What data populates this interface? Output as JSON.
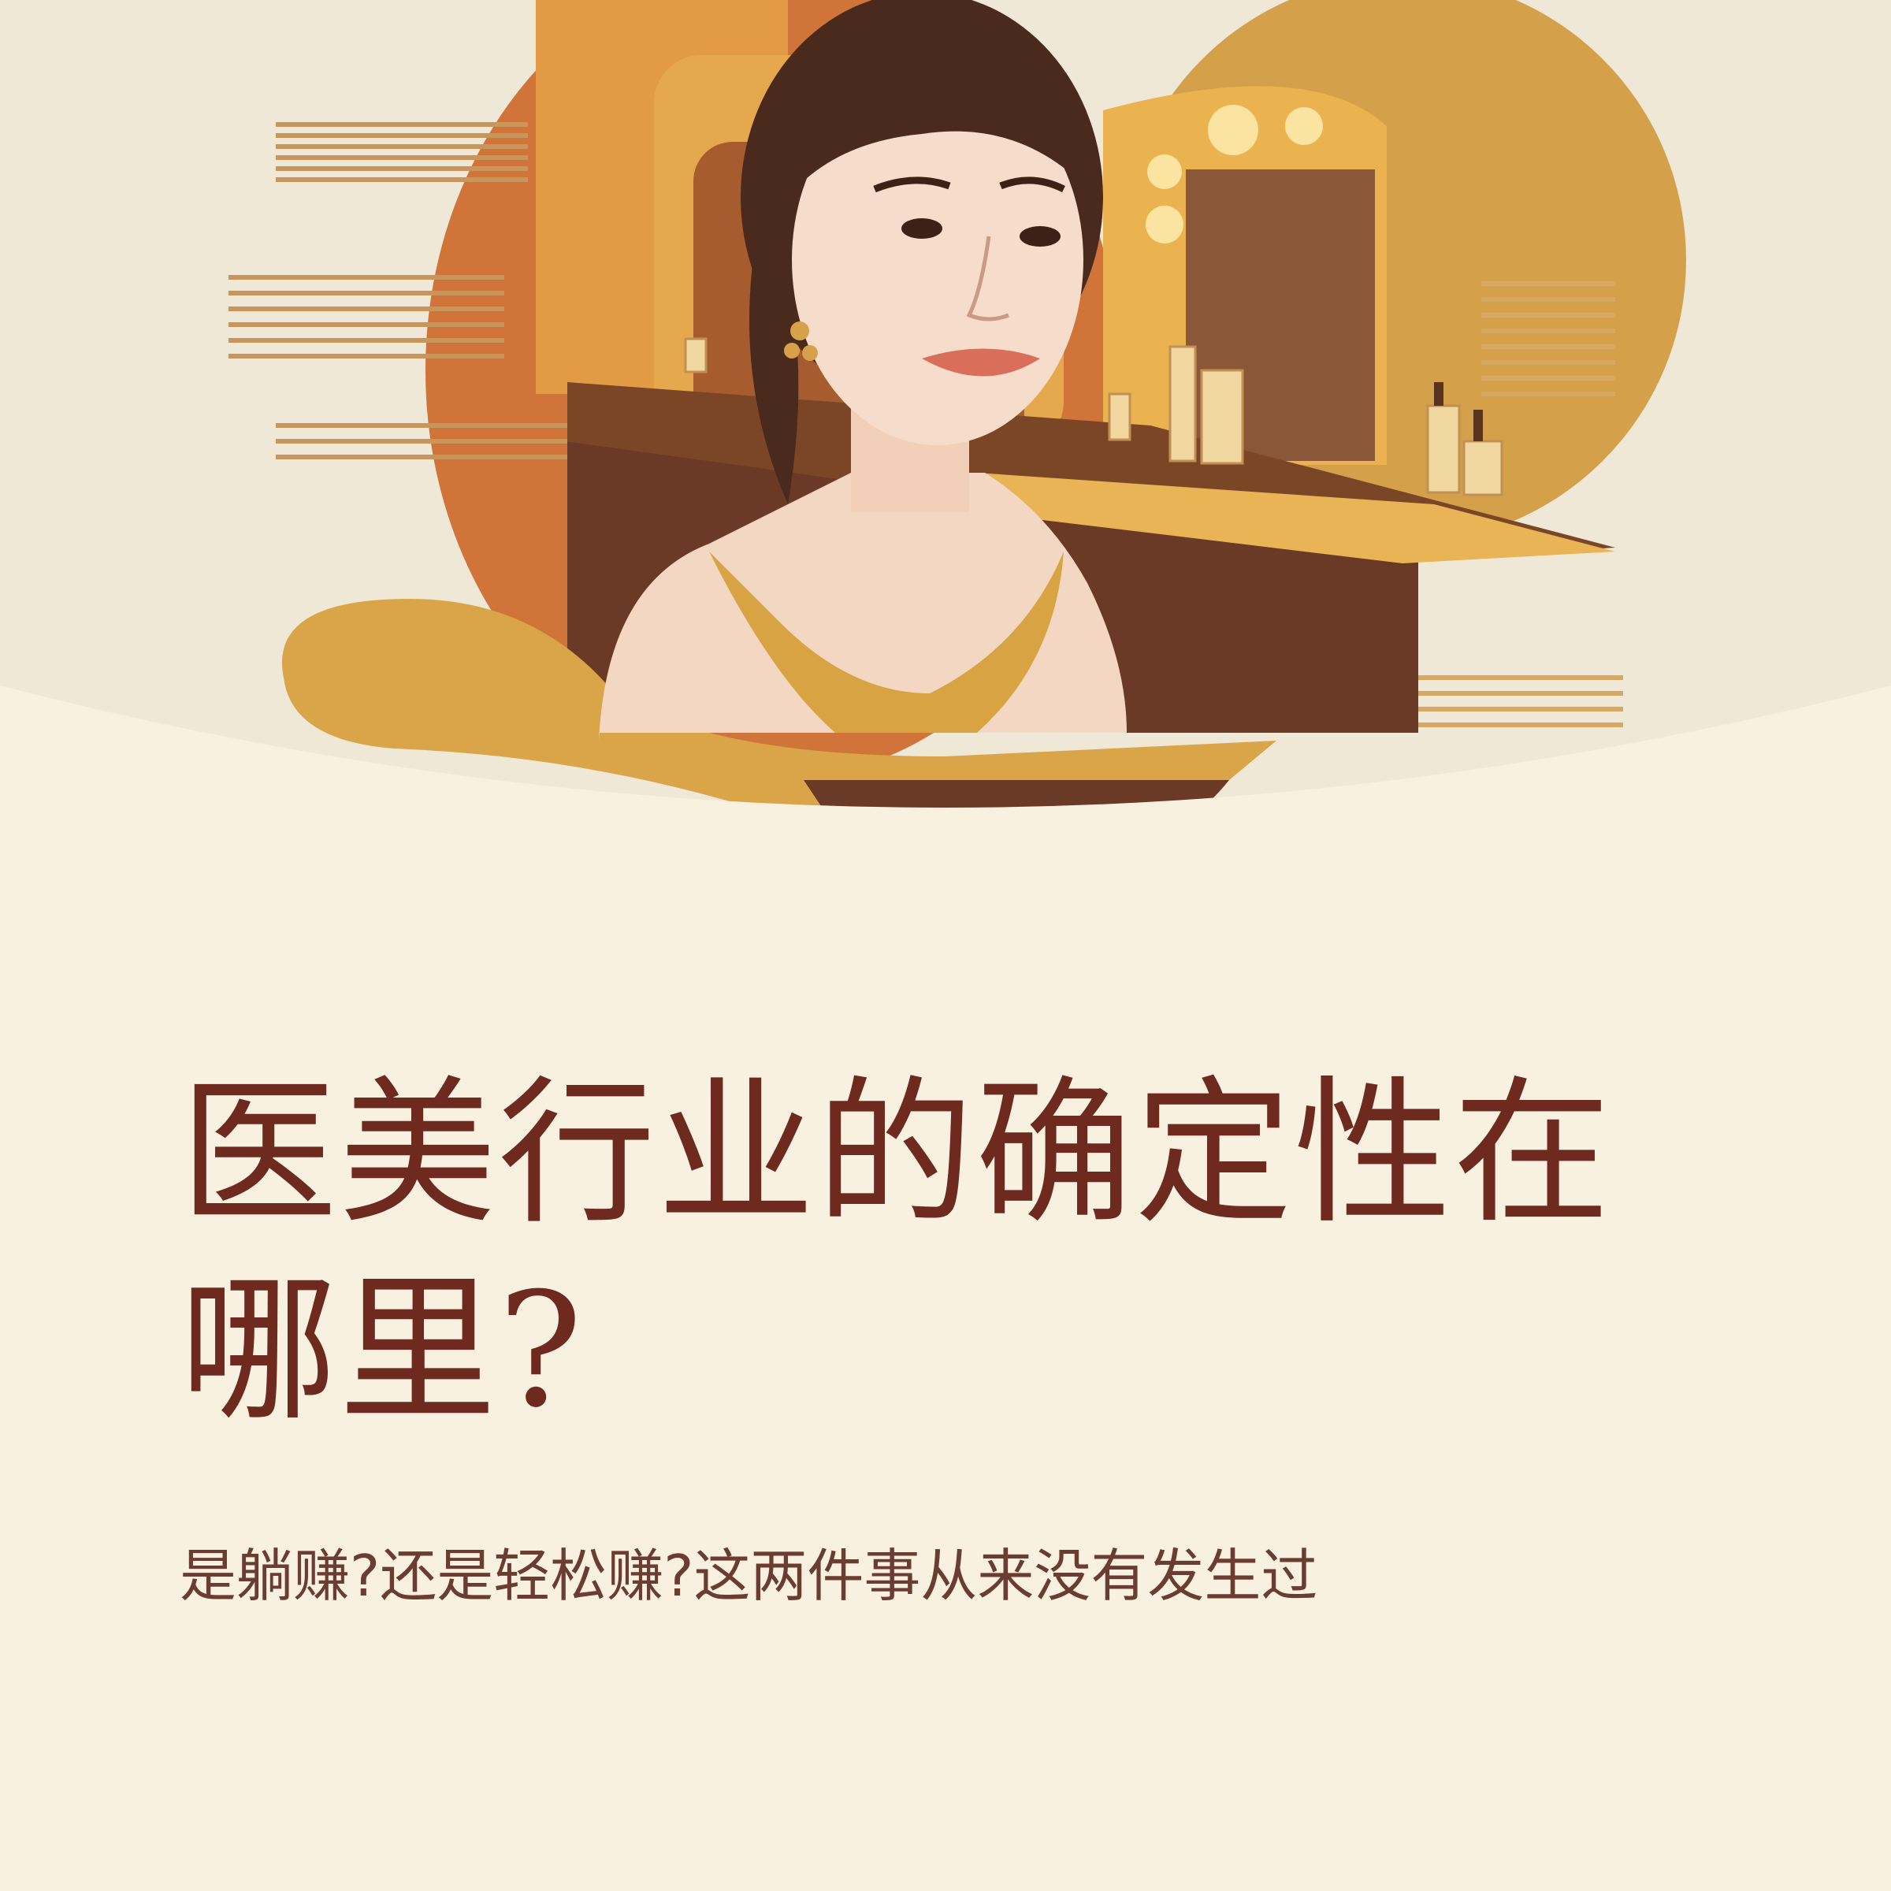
{
  "poster": {
    "title": "医美行业的确定性在哪里?",
    "subtitle": "是躺赚?还是轻松赚?这两件事从来没有发生过"
  },
  "colors": {
    "background": "#f8f1df",
    "title": "#6e2a1f",
    "subtitle": "#6b3d32",
    "gold": "#d9a548",
    "orange": "#d2773a",
    "brown": "#6b3a26"
  },
  "illustration": {
    "subject": "woman at vanity mirror with skincare bottles"
  }
}
